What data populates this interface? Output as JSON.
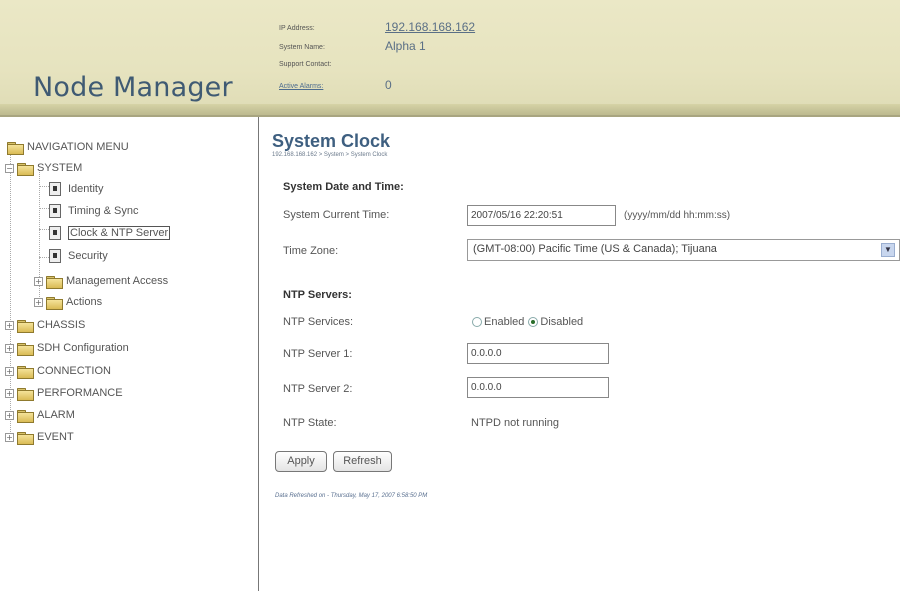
{
  "app": {
    "title": "Node Manager"
  },
  "device_info": {
    "ip_label": "IP Address:",
    "ip_value": "192.168.168.162",
    "system_name_label": "System Name:",
    "system_name_value": "Alpha 1",
    "support_contact_label": "Support Contact:",
    "support_contact_value": "",
    "active_alarms_label": "Active Alarms:",
    "active_alarms_value": "0"
  },
  "sidebar": {
    "root_label": "NAVIGATION MENU",
    "system_label": "SYSTEM",
    "system_items": [
      "Identity",
      "Timing & Sync",
      "Clock & NTP Server",
      "Security"
    ],
    "system_subfolders": [
      "Management Access",
      "Actions"
    ],
    "top_folders": [
      "CHASSIS",
      "SDH Configuration",
      "CONNECTION",
      "PERFORMANCE",
      "ALARM",
      "EVENT"
    ],
    "selected_item": "Clock & NTP Server"
  },
  "page": {
    "title": "System Clock",
    "breadcrumb": "192.168.168.162 > System > System Clock"
  },
  "date_time": {
    "section_title": "System Date and Time:",
    "current_time_label": "System Current Time:",
    "current_time_value": "2007/05/16 22:20:51",
    "current_time_format": "(yyyy/mm/dd hh:mm:ss)",
    "time_zone_label": "Time Zone:",
    "time_zone_value": "(GMT-08:00) Pacific Time (US & Canada); Tijuana"
  },
  "ntp": {
    "section_title": "NTP Servers:",
    "services_label": "NTP Services:",
    "enabled_label": "Enabled",
    "disabled_label": "Disabled",
    "services_selected": "Disabled",
    "server1_label": "NTP Server 1:",
    "server1_value": "0.0.0.0",
    "server2_label": "NTP Server 2:",
    "server2_value": "0.0.0.0",
    "state_label": "NTP State:",
    "state_value": "NTPD not running"
  },
  "actions": {
    "apply_label": "Apply",
    "refresh_label": "Refresh"
  },
  "footer": {
    "refreshed_text": "Data Refreshed on - Thursday, May 17, 2007 6:58:50 PM"
  },
  "colors": {
    "header_bg": "#e6e3bf",
    "title_blue": "#3e5f80",
    "link_blue": "#5a6f86"
  }
}
